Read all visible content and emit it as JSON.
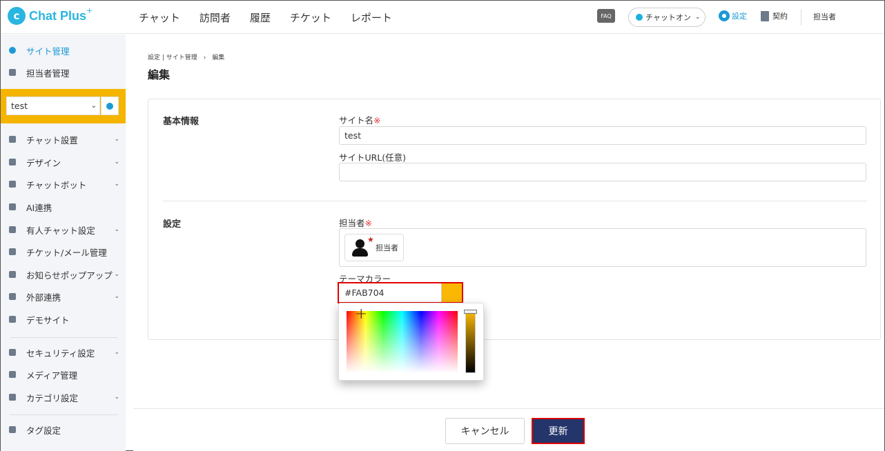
{
  "header": {
    "logo_text": "Chat Plus",
    "logo_plus": "+",
    "nav": [
      "チャット",
      "訪問者",
      "履歴",
      "チケット",
      "レポート"
    ],
    "faq_label": "FAQ",
    "status_label": "チャットオン",
    "settings_label": "設定",
    "contract_label": "契約",
    "user_label": "担当者"
  },
  "sidebar": {
    "top_items": [
      {
        "label": "サイト管理",
        "icon": "gear-icon",
        "active": true
      },
      {
        "label": "担当者管理",
        "icon": "users-icon",
        "active": false
      }
    ],
    "site_selector": {
      "value": "test"
    },
    "items": [
      {
        "label": "チャット設置",
        "icon": "tools-icon",
        "has_chevron": true
      },
      {
        "label": "デザイン",
        "icon": "palette-icon",
        "has_chevron": true
      },
      {
        "label": "チャットボット",
        "icon": "chat-bubble-icon",
        "has_chevron": true
      },
      {
        "label": "AI連携",
        "icon": "pin-icon",
        "has_chevron": false
      },
      {
        "label": "有人チャット設定",
        "icon": "headset-icon",
        "has_chevron": true
      },
      {
        "label": "チケット/メール管理",
        "icon": "list-icon",
        "has_chevron": false
      },
      {
        "label": "お知らせポップアップ",
        "icon": "popup-icon",
        "has_chevron": true
      },
      {
        "label": "外部連携",
        "icon": "share-icon",
        "has_chevron": true
      },
      {
        "label": "デモサイト",
        "icon": "monitor-icon",
        "has_chevron": false
      },
      {
        "label": "セキュリティ設定",
        "icon": "lock-icon",
        "has_chevron": true
      },
      {
        "label": "メディア管理",
        "icon": "image-icon",
        "has_chevron": false
      },
      {
        "label": "カテゴリ設定",
        "icon": "folder-icon",
        "has_chevron": true
      },
      {
        "label": "タグ設定",
        "icon": "tag-icon",
        "has_chevron": false
      }
    ]
  },
  "main": {
    "breadcrumb": "設定 | サイト管理　›　編集",
    "title": "編集",
    "basic_section": "基本情報",
    "site_name_label": "サイト名",
    "required_mark": "※",
    "site_name_value": "test",
    "site_url_label": "サイトURL(任意)",
    "site_url_value": "",
    "settings_section": "設定",
    "agent_label": "担当者",
    "agent_name": "担当者",
    "theme_color_label": "テーマカラー",
    "theme_color_value": "#FAB704",
    "theme_color_hex": "#FAB704"
  },
  "footer": {
    "cancel_label": "キャンセル",
    "update_label": "更新"
  },
  "colors": {
    "accent": "#1C9AD6",
    "site_box": "#F5B400",
    "update_button": "#23356A",
    "highlight": "#E00000"
  }
}
